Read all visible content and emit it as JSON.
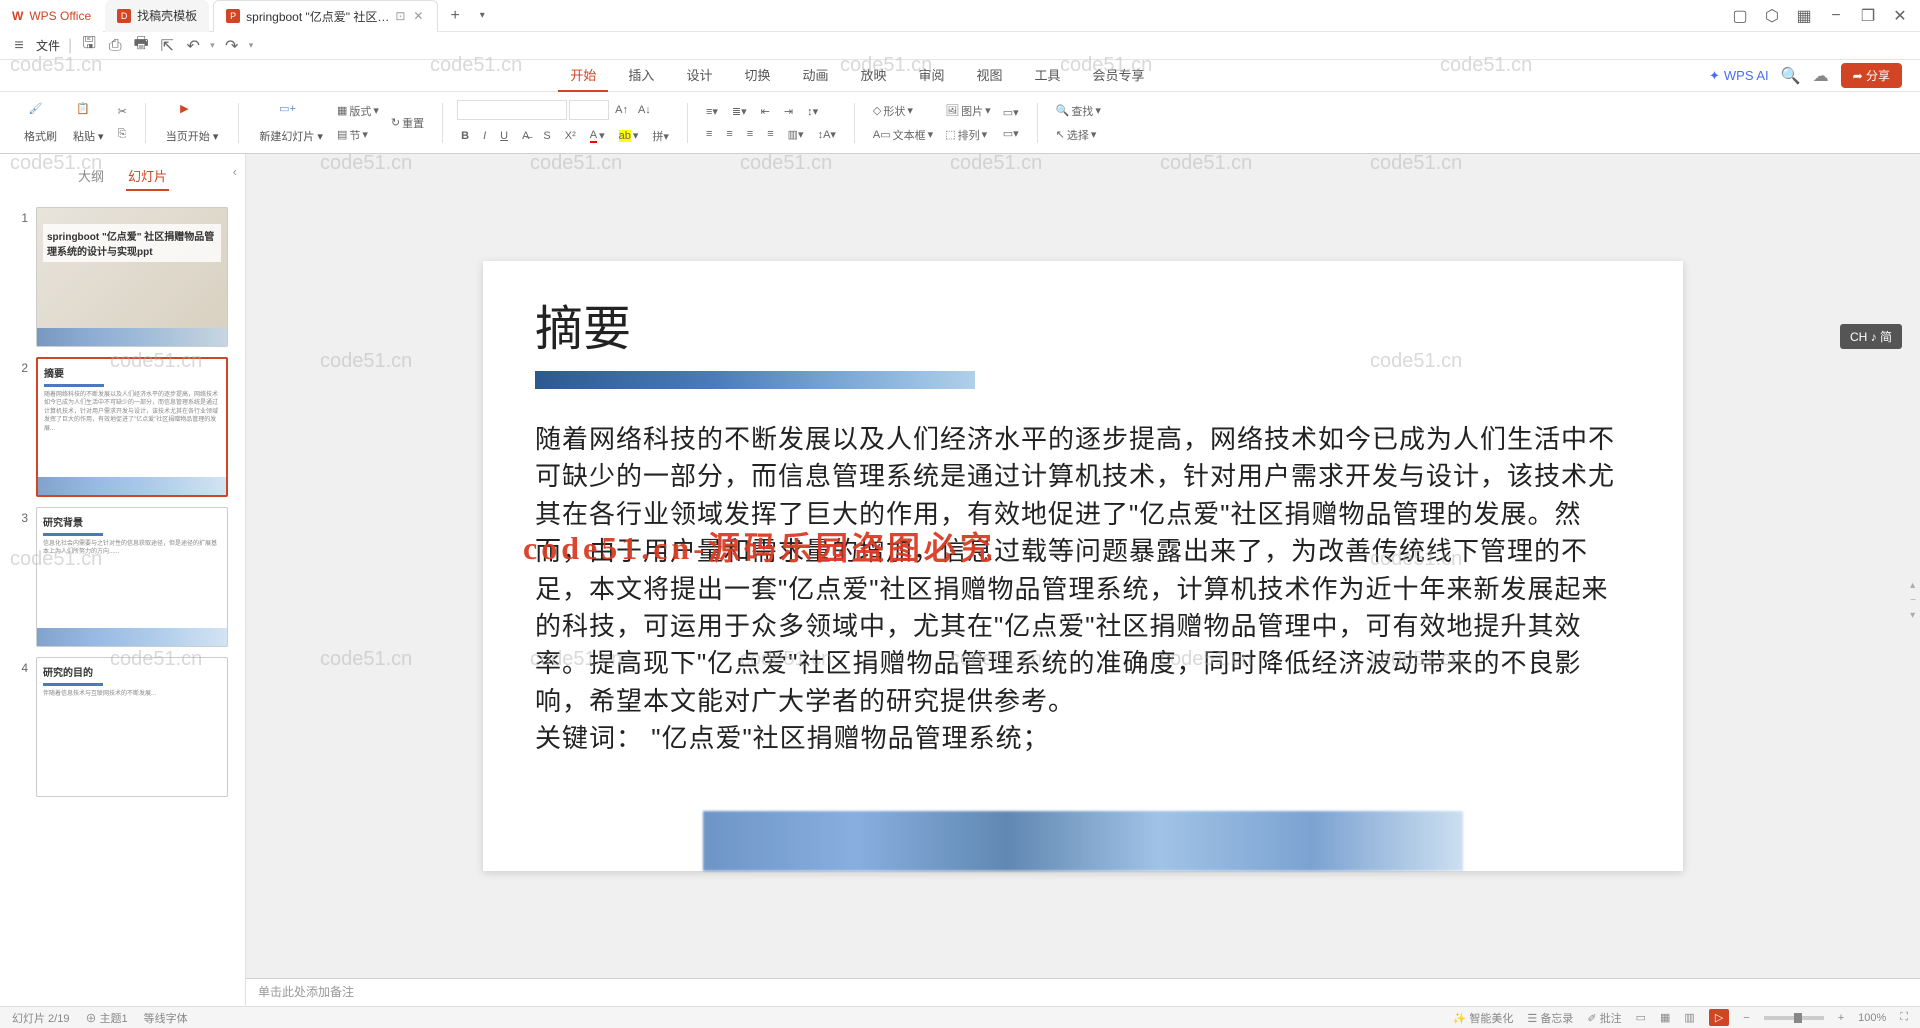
{
  "titlebar": {
    "app": "WPS Office",
    "tabs": [
      {
        "label": "找稿壳模板",
        "icon": "D"
      },
      {
        "label": "springboot \"亿点爱\" 社区…",
        "icon": "P"
      }
    ],
    "window": {
      "min": "−",
      "max": "❐",
      "close": "✕"
    }
  },
  "quickbar": {
    "menu_icon": "≡",
    "file": "文件",
    "undo": "↶",
    "redo": "↷"
  },
  "menubar": {
    "items": [
      "开始",
      "插入",
      "设计",
      "切换",
      "动画",
      "放映",
      "审阅",
      "视图",
      "工具",
      "会员专享"
    ],
    "active": 0,
    "ai": "WPS AI",
    "share": "分享",
    "cloud": "☁"
  },
  "ribbon": {
    "format_painter": "格式刷",
    "paste": "粘贴",
    "from_current": "当页开始",
    "new_slide": "新建幻灯片",
    "layout": "版式",
    "section": "节",
    "reset": "重置",
    "shape": "形状",
    "picture": "图片",
    "textbox": "文本框",
    "arrange": "排列",
    "find": "查找",
    "select": "选择"
  },
  "sidepanel": {
    "tabs": [
      "大纲",
      "幻灯片"
    ],
    "active": 1,
    "slides": [
      {
        "n": "1",
        "title": "springboot \"亿点爱\" 社区捐赠物品管理系统的设计与实现ppt"
      },
      {
        "n": "2",
        "title": "摘要"
      },
      {
        "n": "3",
        "title": "研究背景"
      },
      {
        "n": "4",
        "title": "研究的目的"
      }
    ]
  },
  "slide": {
    "title": "摘要",
    "body": "随着网络科技的不断发展以及人们经济水平的逐步提高，网络技术如今已成为人们生活中不可缺少的一部分，而信息管理系统是通过计算机技术，针对用户需求开发与设计，该技术尤其在各行业领域发挥了巨大的作用，有效地促进了\"亿点爱\"社区捐赠物品管理的发展。然而，由于用户量和需求量的增加，信息过载等问题暴露出来了，为改善传统线下管理的不足，本文将提出一套\"亿点爱\"社区捐赠物品管理系统，计算机技术作为近十年来新发展起来的科技，可运用于众多领域中，尤其在\"亿点爱\"社区捐赠物品管理中，可有效地提升其效率。提高现下\"亿点爱\"社区捐赠物品管理系统的准确度，同时降低经济波动带来的不良影响，希望本文能对广大学者的研究提供参考。",
    "keywords": "关键词： \"亿点爱\"社区捐赠物品管理系统；",
    "watermark_red": "code51.cn-源码乐园盗图必究"
  },
  "notes": {
    "placeholder": "单击此处添加备注"
  },
  "statusbar": {
    "left": [
      "幻灯片 2/19",
      "主题1",
      "等线字体"
    ],
    "right": [
      "智能美化",
      "备忘录",
      "批注",
      "100%"
    ]
  },
  "ime": "CH ♪ 简",
  "wm": "code51.cn"
}
